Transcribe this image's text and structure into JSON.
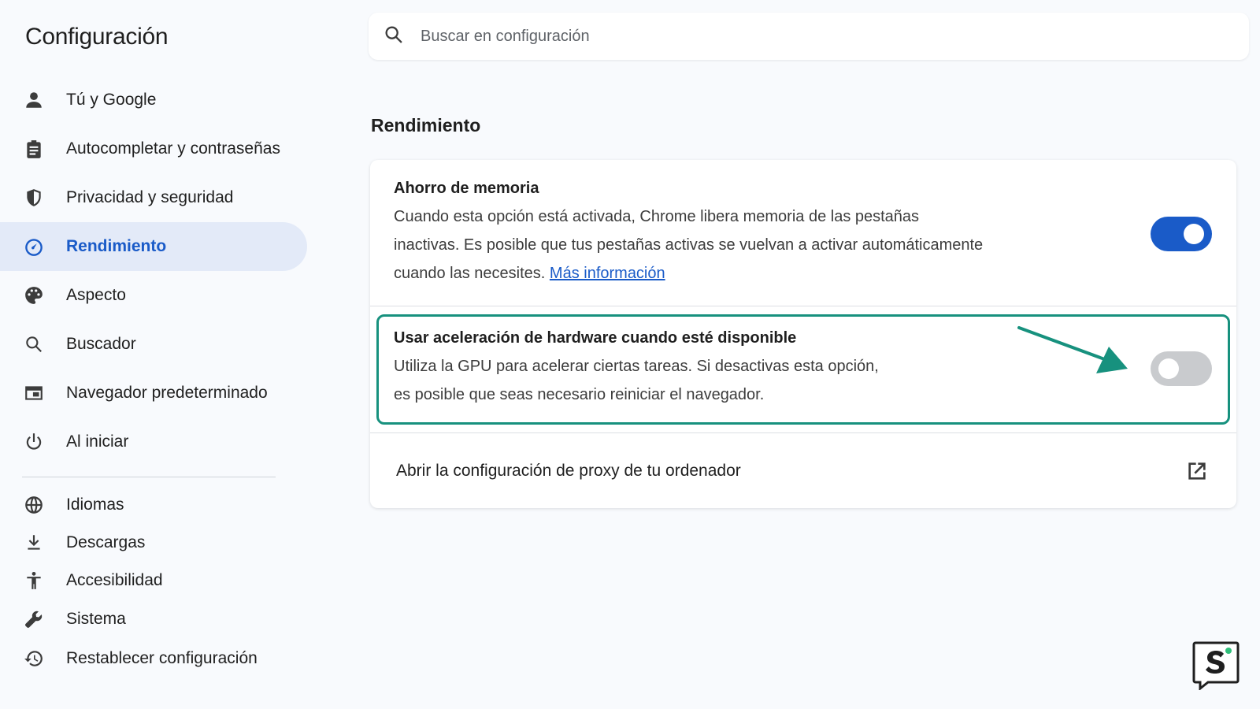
{
  "app": {
    "title": "Configuración"
  },
  "search": {
    "placeholder": "Buscar en configuración"
  },
  "sidebar": {
    "items": [
      {
        "label": "Tú y Google",
        "icon": "person-icon"
      },
      {
        "label": "Autocompletar y contraseñas",
        "icon": "clipboard-icon"
      },
      {
        "label": "Privacidad y seguridad",
        "icon": "shield-icon"
      },
      {
        "label": "Rendimiento",
        "icon": "speedometer-icon",
        "active": true
      },
      {
        "label": "Aspecto",
        "icon": "palette-icon"
      },
      {
        "label": "Buscador",
        "icon": "search-icon"
      },
      {
        "label": "Navegador predeterminado",
        "icon": "browser-window-icon"
      },
      {
        "label": "Al iniciar",
        "icon": "power-icon"
      }
    ],
    "secondary_items": [
      {
        "label": "Idiomas",
        "icon": "globe-icon"
      },
      {
        "label": "Descargas",
        "icon": "download-icon"
      },
      {
        "label": "Accesibilidad",
        "icon": "accessibility-icon"
      },
      {
        "label": "Sistema",
        "icon": "wrench-icon"
      },
      {
        "label": "Restablecer configuración",
        "icon": "history-icon"
      }
    ]
  },
  "main": {
    "section_title": "Rendimiento",
    "memory_saver": {
      "title": "Ahorro de memoria",
      "desc_line1": "Cuando esta opción está activada, Chrome libera memoria de las pestañas",
      "desc_line2": "inactivas. Es posible que tus pestañas activas se vuelvan a activar automáticamente",
      "desc_line3_prefix": "cuando las necesites.",
      "link": "Más información",
      "enabled": true
    },
    "hardware_acceleration": {
      "title": "Usar aceleración de hardware cuando esté disponible",
      "desc_line1": "Utiliza la GPU para acelerar ciertas tareas. Si desactivas esta opción,",
      "desc_line2": "es posible que seas necesario reiniciar el navegador.",
      "enabled": false
    },
    "proxy": {
      "label": "Abrir la configuración de proxy de tu ordenador",
      "icon": "external-link-icon"
    }
  },
  "colors": {
    "accent": "#1a5bc8",
    "highlight_border": "#17917e",
    "active_nav_bg": "#e3eaf8"
  }
}
